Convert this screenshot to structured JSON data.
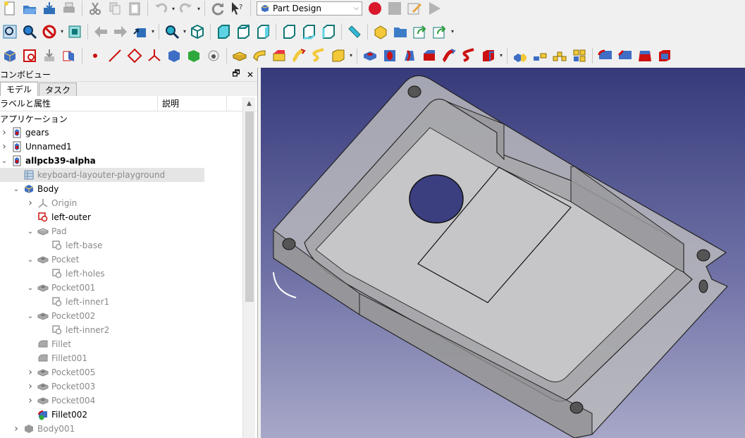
{
  "toolbar": {
    "workbench": "Part Design"
  },
  "combo": {
    "title": "コンボビュー",
    "tabs": [
      "モデル",
      "タスク"
    ],
    "col_label": "ラベルと属性",
    "col_desc": "説明",
    "root_label": "アプリケーション"
  },
  "tree": [
    {
      "label": "gears",
      "indent": 0,
      "expander": "right",
      "icon": "document",
      "style": ""
    },
    {
      "label": "Unnamed1",
      "indent": 0,
      "expander": "right",
      "icon": "document",
      "style": ""
    },
    {
      "label": "allpcb39-alpha",
      "indent": 0,
      "expander": "down",
      "icon": "document",
      "style": "bold"
    },
    {
      "label": "keyboard-layouter-playground",
      "indent": 1,
      "expander": "",
      "icon": "spreadsheet",
      "style": "dim sel"
    },
    {
      "label": "Body",
      "indent": 1,
      "expander": "down",
      "icon": "body",
      "style": ""
    },
    {
      "label": "Origin",
      "indent": 2,
      "expander": "right",
      "icon": "origin",
      "style": "dim"
    },
    {
      "label": "left-outer",
      "indent": 2,
      "expander": "",
      "icon": "sketch-red",
      "style": ""
    },
    {
      "label": "Pad",
      "indent": 2,
      "expander": "down",
      "icon": "pad",
      "style": "dim"
    },
    {
      "label": "left-base",
      "indent": 3,
      "expander": "",
      "icon": "sketch-gray",
      "style": "dim"
    },
    {
      "label": "Pocket",
      "indent": 2,
      "expander": "down",
      "icon": "pocket",
      "style": "dim"
    },
    {
      "label": "left-holes",
      "indent": 3,
      "expander": "",
      "icon": "sketch-gray",
      "style": "dim"
    },
    {
      "label": "Pocket001",
      "indent": 2,
      "expander": "down",
      "icon": "pocket",
      "style": "dim"
    },
    {
      "label": "left-inner1",
      "indent": 3,
      "expander": "",
      "icon": "sketch-gray",
      "style": "dim"
    },
    {
      "label": "Pocket002",
      "indent": 2,
      "expander": "down",
      "icon": "pocket",
      "style": "dim"
    },
    {
      "label": "left-inner2",
      "indent": 3,
      "expander": "",
      "icon": "sketch-gray",
      "style": "dim"
    },
    {
      "label": "Fillet",
      "indent": 2,
      "expander": "",
      "icon": "fillet",
      "style": "dim"
    },
    {
      "label": "Fillet001",
      "indent": 2,
      "expander": "",
      "icon": "fillet",
      "style": "dim"
    },
    {
      "label": "Pocket005",
      "indent": 2,
      "expander": "right",
      "icon": "pocket",
      "style": "dim"
    },
    {
      "label": "Pocket003",
      "indent": 2,
      "expander": "right",
      "icon": "pocket",
      "style": "dim"
    },
    {
      "label": "Pocket004",
      "indent": 2,
      "expander": "right",
      "icon": "pocket",
      "style": "dim"
    },
    {
      "label": "Fillet002",
      "indent": 2,
      "expander": "",
      "icon": "fillet-active",
      "style": ""
    },
    {
      "label": "Body001",
      "indent": 1,
      "expander": "right",
      "icon": "body-gray",
      "style": "dim"
    }
  ]
}
